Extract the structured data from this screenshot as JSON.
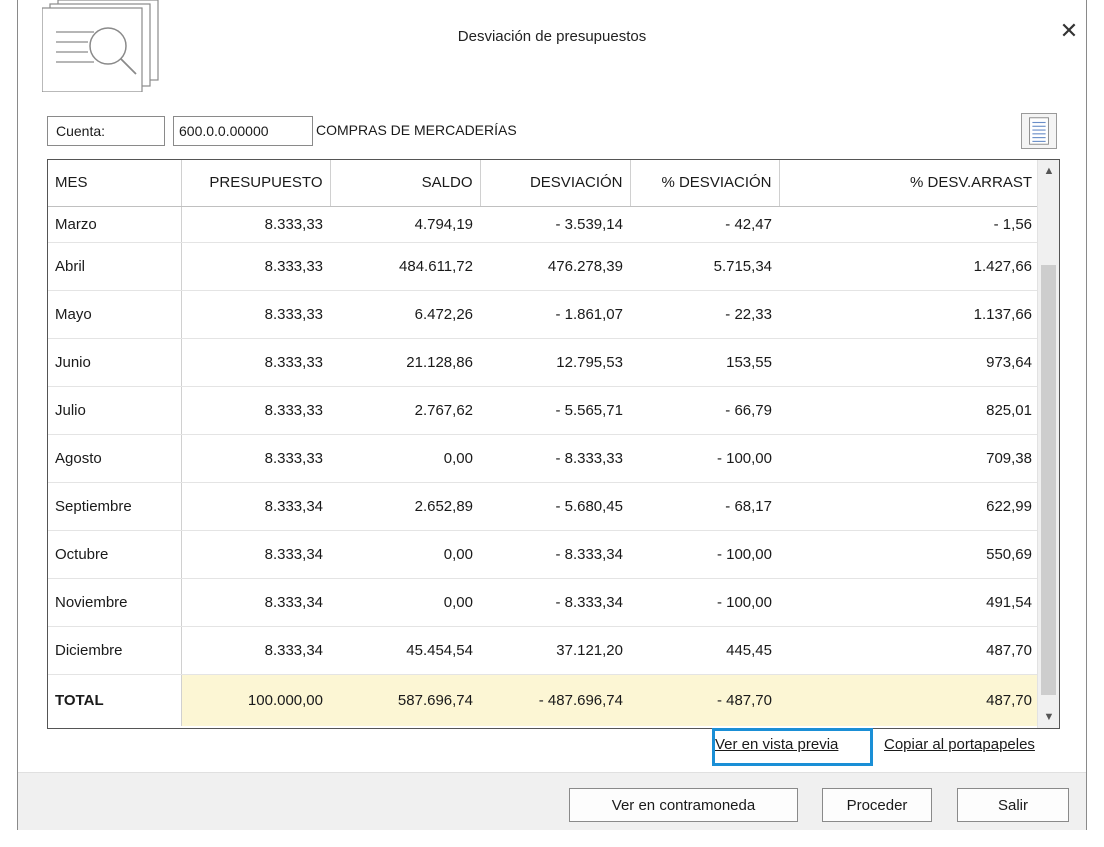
{
  "window": {
    "title": "Desviación de presupuestos"
  },
  "account": {
    "label": "Cuenta:",
    "code": "600.0.0.00000",
    "name": "COMPRAS DE MERCADERÍAS"
  },
  "table": {
    "headers": [
      "MES",
      "PRESUPUESTO",
      "SALDO",
      "DESVIACIÓN",
      "% DESVIACIÓN",
      "% DESV.ARRAST"
    ],
    "rows": [
      [
        "Marzo",
        "8.333,33",
        "4.794,19",
        "- 3.539,14",
        "- 42,47",
        "- 1,56"
      ],
      [
        "Abril",
        "8.333,33",
        "484.611,72",
        "476.278,39",
        "5.715,34",
        "1.427,66"
      ],
      [
        "Mayo",
        "8.333,33",
        "6.472,26",
        "- 1.861,07",
        "- 22,33",
        "1.137,66"
      ],
      [
        "Junio",
        "8.333,33",
        "21.128,86",
        "12.795,53",
        "153,55",
        "973,64"
      ],
      [
        "Julio",
        "8.333,33",
        "2.767,62",
        "- 5.565,71",
        "- 66,79",
        "825,01"
      ],
      [
        "Agosto",
        "8.333,33",
        "0,00",
        "- 8.333,33",
        "- 100,00",
        "709,38"
      ],
      [
        "Septiembre",
        "8.333,34",
        "2.652,89",
        "- 5.680,45",
        "- 68,17",
        "622,99"
      ],
      [
        "Octubre",
        "8.333,34",
        "0,00",
        "- 8.333,34",
        "- 100,00",
        "550,69"
      ],
      [
        "Noviembre",
        "8.333,34",
        "0,00",
        "- 8.333,34",
        "- 100,00",
        "491,54"
      ],
      [
        "Diciembre",
        "8.333,34",
        "45.454,54",
        "37.121,20",
        "445,45",
        "487,70"
      ]
    ],
    "total": [
      "TOTAL",
      "100.000,00",
      "587.696,74",
      "- 487.696,74",
      "- 487,70",
      "487,70"
    ]
  },
  "links": {
    "preview": "Ver en vista previa",
    "copy": "Copiar al portapapeles"
  },
  "buttons": {
    "contramoneda": "Ver en contramoneda",
    "proceder": "Proceder",
    "salir": "Salir"
  },
  "icons": {
    "close": "close-icon",
    "document_search": "document-search-icon",
    "list": "list-icon"
  },
  "colors": {
    "total_row_bg": "#fcf6d4",
    "highlight_border": "#1a8fd6"
  }
}
